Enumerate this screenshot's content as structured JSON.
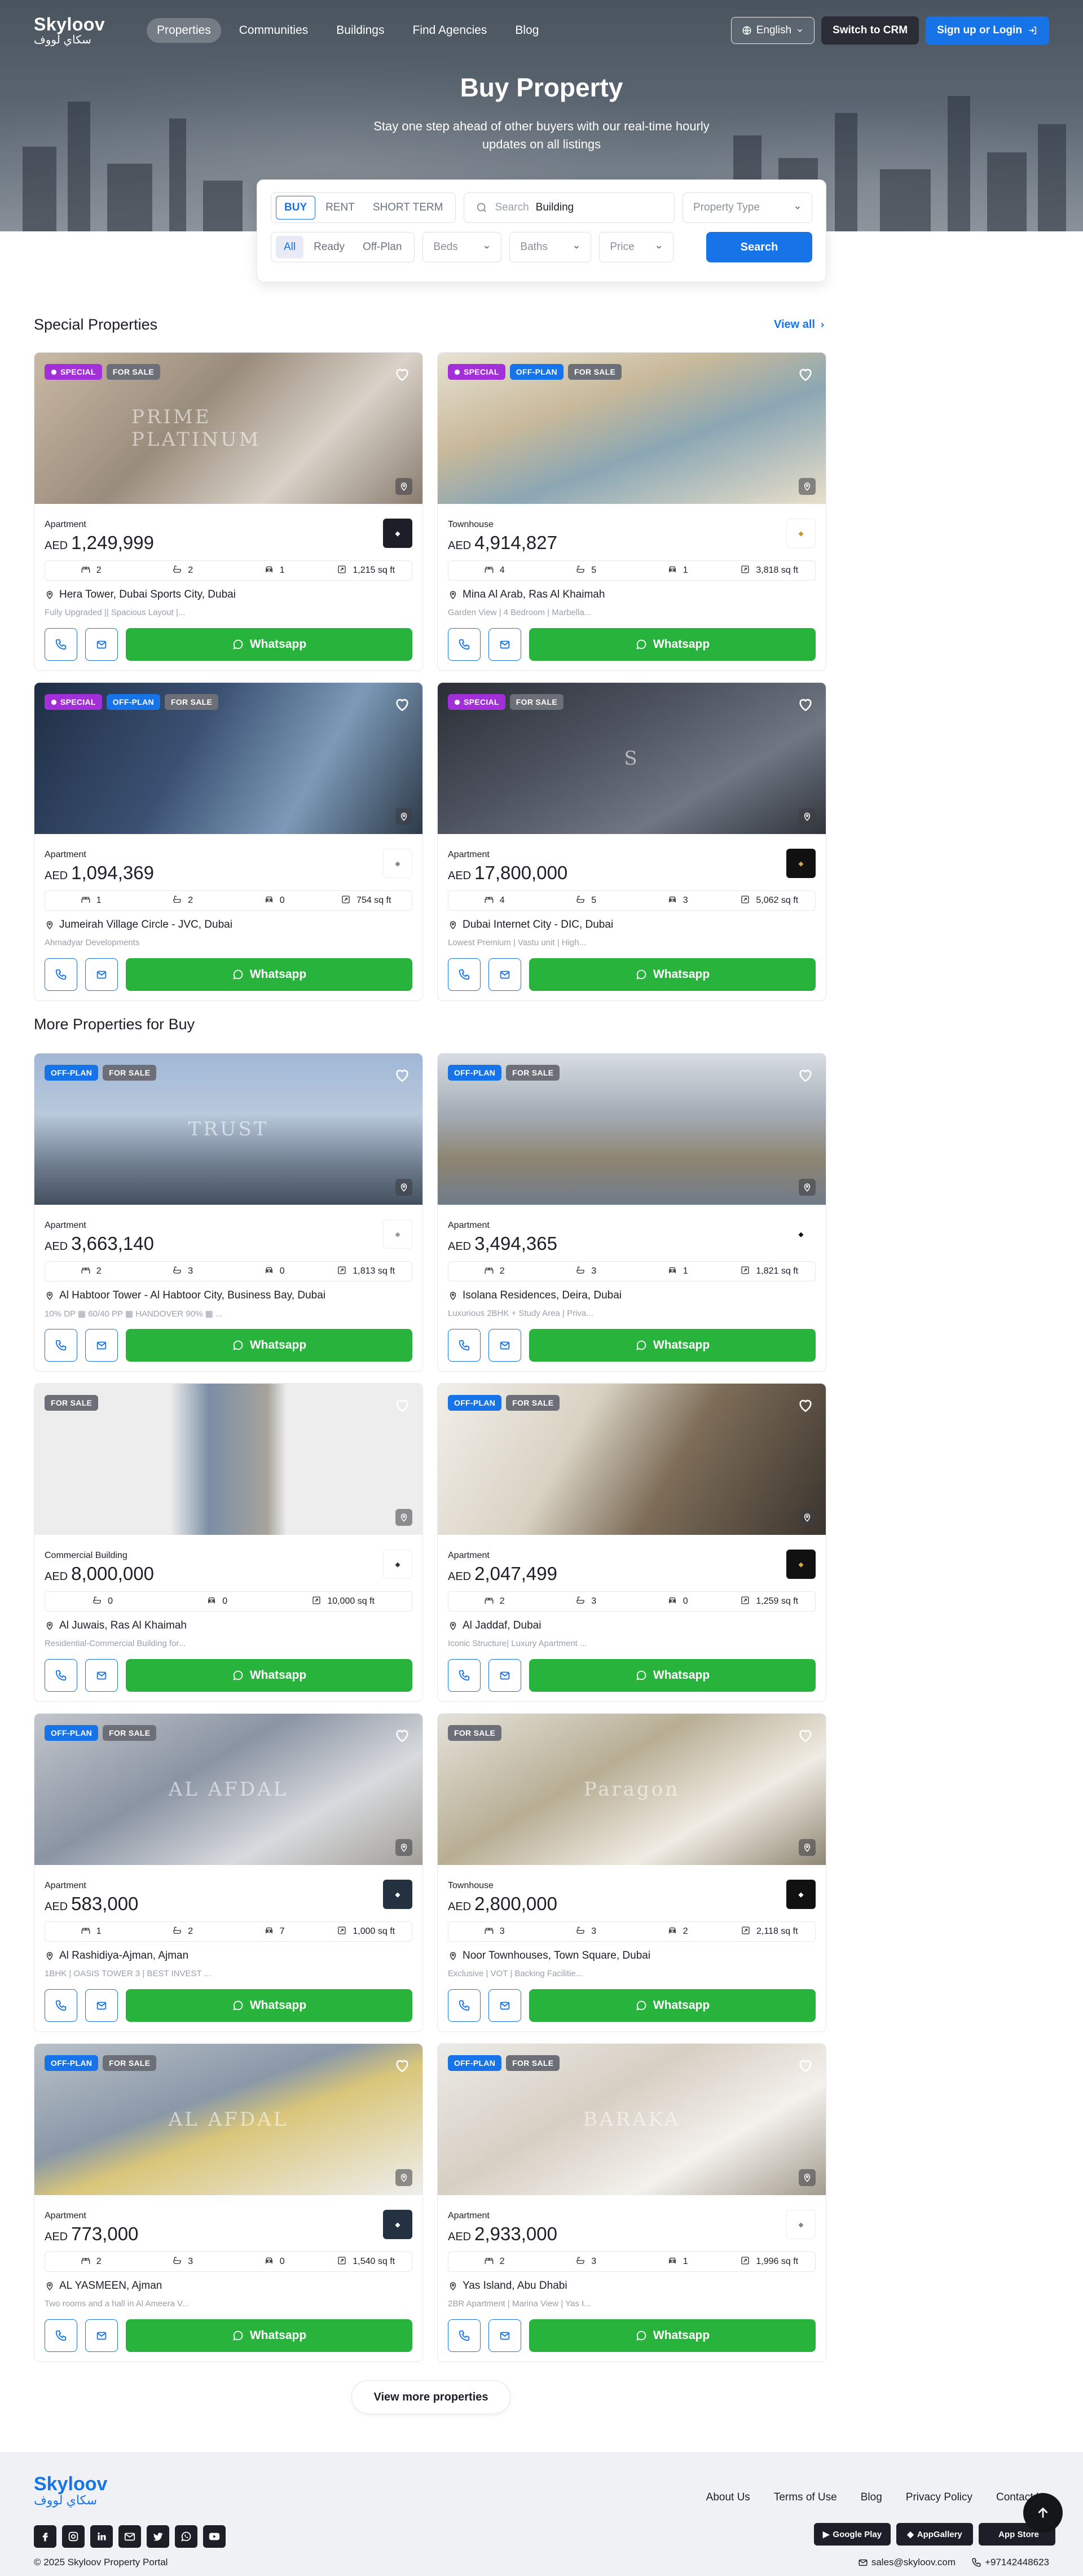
{
  "nav": {
    "logo_en": "Skyloov",
    "logo_ar": "سكاي لووف",
    "links": [
      "Properties",
      "Communities",
      "Buildings",
      "Find Agencies",
      "Blog"
    ],
    "language": "English",
    "crm": "Switch to CRM",
    "signup": "Sign up or Login"
  },
  "hero": {
    "title": "Buy Property",
    "subtitle": "Stay one step ahead of other buyers with our real-time hourly updates on all listings"
  },
  "search": {
    "modes": [
      "BUY",
      "RENT",
      "SHORT TERM"
    ],
    "placeholder": "Search",
    "query": "Building",
    "property_type": "Property Type",
    "status": [
      "All",
      "Ready",
      "Off-Plan"
    ],
    "beds": "Beds",
    "baths": "Baths",
    "price": "Price",
    "button": "Search"
  },
  "special": {
    "title": "Special Properties",
    "view_all": "View all"
  },
  "more": {
    "title": "More Properties for Buy",
    "view_more": "View more properties"
  },
  "badges": {
    "special": "SPECIAL",
    "offplan": "OFF-PLAN",
    "forsale": "FOR SALE"
  },
  "currency": "AED",
  "whatsapp": "Whatsapp",
  "special_listings": [
    {
      "type": "Apartment",
      "price": "1,249,999",
      "specs": [
        "2",
        "2",
        "1",
        "1,215 sq ft"
      ],
      "location": "Hera Tower, Dubai Sports City, Dubai",
      "desc": "Fully Upgraded || Spacious Layout |...",
      "watermark": "PRIME PLATINUM"
    },
    {
      "type": "Townhouse",
      "price": "4,914,827",
      "specs": [
        "4",
        "5",
        "1",
        "3,818 sq ft"
      ],
      "location": "Mina Al Arab, Ras Al Khaimah",
      "desc": "Garden View | 4 Bedroom | Marbella...",
      "watermark": ""
    },
    {
      "type": "Apartment",
      "price": "1,094,369",
      "specs": [
        "1",
        "2",
        "0",
        "754 sq ft"
      ],
      "location": "Jumeirah Village Circle - JVC, Dubai",
      "desc": "Ahmadyar Developments",
      "watermark": ""
    },
    {
      "type": "Apartment",
      "price": "17,800,000",
      "specs": [
        "4",
        "5",
        "3",
        "5,062 sq ft"
      ],
      "location": "Dubai Internet City - DIC, Dubai",
      "desc": "Lowest Premium | Vastu unit | High...",
      "watermark": "S"
    }
  ],
  "more_listings": [
    {
      "type": "Apartment",
      "price": "3,663,140",
      "specs": [
        "2",
        "3",
        "0",
        "1,813 sq ft"
      ],
      "location": "Al Habtoor Tower - Al Habtoor City, Business Bay, Dubai",
      "desc": "10% DP  ▦ 60/40 PP  ▦ HANDOVER 90% ▦ ...",
      "watermark": "TRUST"
    },
    {
      "type": "Apartment",
      "price": "3,494,365",
      "specs": [
        "2",
        "3",
        "1",
        "1,821 sq ft"
      ],
      "location": "Isolana Residences, Deira, Dubai",
      "desc": "Luxurious 2BHK + Study Area | Priva...",
      "watermark": ""
    },
    {
      "type": "Commercial Building",
      "price": "8,000,000",
      "specs": [
        "0",
        "0",
        "10,000 sq ft"
      ],
      "location": "Al Juwais, Ras Al Khaimah",
      "desc": "Residential-Commercial Building for...",
      "watermark": ""
    },
    {
      "type": "Apartment",
      "price": "2,047,499",
      "specs": [
        "2",
        "3",
        "0",
        "1,259 sq ft"
      ],
      "location": "Al Jaddaf, Dubai",
      "desc": "Iconic Structure| Luxury Apartment ...",
      "watermark": ""
    },
    {
      "type": "Apartment",
      "price": "583,000",
      "specs": [
        "1",
        "2",
        "7",
        "1,000 sq ft"
      ],
      "location": "Al Rashidiya-Ajman, Ajman",
      "desc": "1BHK | OASIS TOWER 3 | BEST INVEST ...",
      "watermark": "AL AFDAL"
    },
    {
      "type": "Townhouse",
      "price": "2,800,000",
      "specs": [
        "3",
        "3",
        "2",
        "2,118 sq ft"
      ],
      "location": "Noor Townhouses, Town Square, Dubai",
      "desc": "Exclusive | VOT | Backing Facilitie...",
      "watermark": "Paragon"
    },
    {
      "type": "Apartment",
      "price": "773,000",
      "specs": [
        "2",
        "3",
        "0",
        "1,540 sq ft"
      ],
      "location": "AL YASMEEN, Ajman",
      "desc": "Two rooms and a hall in Al Ameera V...",
      "watermark": "AL AFDAL"
    },
    {
      "type": "Apartment",
      "price": "2,933,000",
      "specs": [
        "2",
        "3",
        "1",
        "1,996 sq ft"
      ],
      "location": "Yas Island, Abu Dhabi",
      "desc": "2BR Apartment | Marina View | Yas I...",
      "watermark": "BARAKA"
    }
  ],
  "footer": {
    "logo_en": "Skyloov",
    "logo_ar": "سكاي لووف",
    "links": [
      "About Us",
      "Terms of Use",
      "Blog",
      "Privacy Policy",
      "Contact Us"
    ],
    "copyright": "© 2025 Skyloov Property Portal",
    "stores": [
      "Google Play",
      "AppGallery",
      "App Store"
    ],
    "email": "sales@skyloov.com",
    "phone": "+97142448623"
  },
  "colors": {
    "primary": "#1673e8",
    "whatsapp": "#27b33c",
    "special": "#a32fd8",
    "forsale": "#6c6f77"
  }
}
